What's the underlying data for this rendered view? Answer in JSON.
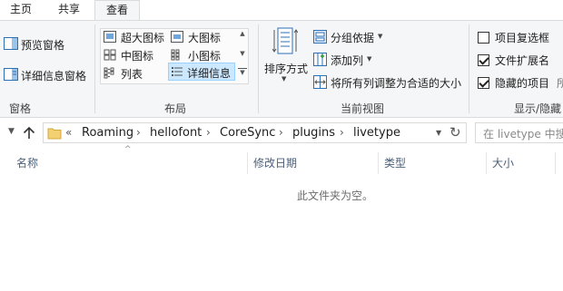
{
  "tabs": [
    {
      "label": "主页"
    },
    {
      "label": "共享"
    },
    {
      "label": "查看"
    }
  ],
  "ribbon": {
    "panes": {
      "preview_pane": "预览窗格",
      "details_pane": "详细信息窗格",
      "group_label": "窗格"
    },
    "layout": {
      "extra_large_icons": "超大图标",
      "large_icons": "大图标",
      "medium_icons": "中图标",
      "small_icons": "小图标",
      "list": "列表",
      "details": "详细信息",
      "group_label": "布局"
    },
    "current_view": {
      "sort_by": "排序方式",
      "group_by": "分组依据",
      "add_columns": "添加列",
      "size_all_columns": "将所有列调整为合适的大小",
      "group_label": "当前视图"
    },
    "show_hide": {
      "item_checkboxes": "项目复选框",
      "item_checkboxes_checked": false,
      "file_extensions": "文件扩展名",
      "file_extensions_checked": true,
      "hidden_items": "隐藏的项目",
      "hidden_items_checked": true,
      "hide_selected_partial": "所",
      "group_label": "显示/隐藏"
    }
  },
  "address_bar": {
    "overflow": "«",
    "breadcrumbs": [
      "Roaming",
      "hellofont",
      "CoreSync",
      "plugins",
      "livetype"
    ]
  },
  "search": {
    "placeholder": "在 livetype 中搜"
  },
  "columns": [
    {
      "label": "名称"
    },
    {
      "label": "修改日期"
    },
    {
      "label": "类型"
    },
    {
      "label": "大小"
    }
  ],
  "empty_message": "此文件夹为空。",
  "colors": {
    "ribbon_bg": "#f5f6f7",
    "selected_bg": "#cce8ff",
    "header_text": "#4c607a",
    "folder_yellow": "#f3d071"
  }
}
